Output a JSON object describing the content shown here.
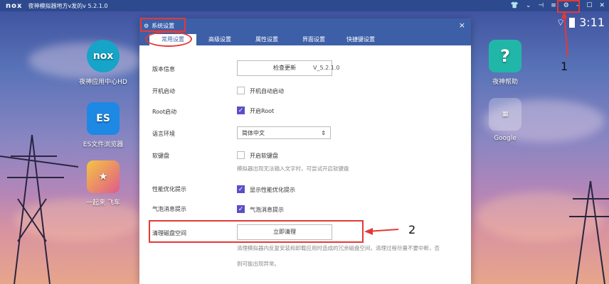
{
  "titlebar": {
    "logo": "nox",
    "title": "夜神模拟器地方v发的v 5.2.1.0"
  },
  "statusbar": {
    "time": "3:11"
  },
  "left_apps": [
    {
      "label": "夜神应用中心HD"
    },
    {
      "label": "ES文件浏览器"
    },
    {
      "label": "一起来 飞车"
    }
  ],
  "right_apps": [
    {
      "label": "夜神帮助"
    },
    {
      "label": "Google"
    }
  ],
  "dialog": {
    "title": "系统设置",
    "tabs": [
      "常用设置",
      "高级设置",
      "属性设置",
      "界面设置",
      "快捷键设置"
    ],
    "version": {
      "label": "版本信息",
      "button": "检查更新",
      "value": "V_5.2.1.0"
    },
    "autostart": {
      "label": "开机启动",
      "checkbox": "开机自动启动"
    },
    "root": {
      "label": "Root启动",
      "checkbox": "开启Root"
    },
    "language": {
      "label": "语言环境",
      "value": "简体中文"
    },
    "keyboard": {
      "label": "软键盘",
      "checkbox": "开启软键盘",
      "hint": "模拟器出现无法输入文字时，可尝试开启软键盘"
    },
    "perf": {
      "label": "性能优化提示",
      "checkbox": "显示性能优化提示"
    },
    "bubble": {
      "label": "气泡消息提示",
      "checkbox": "气泡消息提示"
    },
    "disk": {
      "label": "清理磁盘空间",
      "button": "立即清理",
      "hint1": "清理模拟器内反复安装和卸载应用时造成的冗余磁盘空间，清理过程尽量不要中断，否",
      "hint2": "则可能出现异常。"
    }
  },
  "annotations": {
    "n1": "1",
    "n2": "2"
  },
  "colors": {
    "accent": "#3d5fa8",
    "check": "#5a4fc7",
    "annot": "#e53935"
  }
}
